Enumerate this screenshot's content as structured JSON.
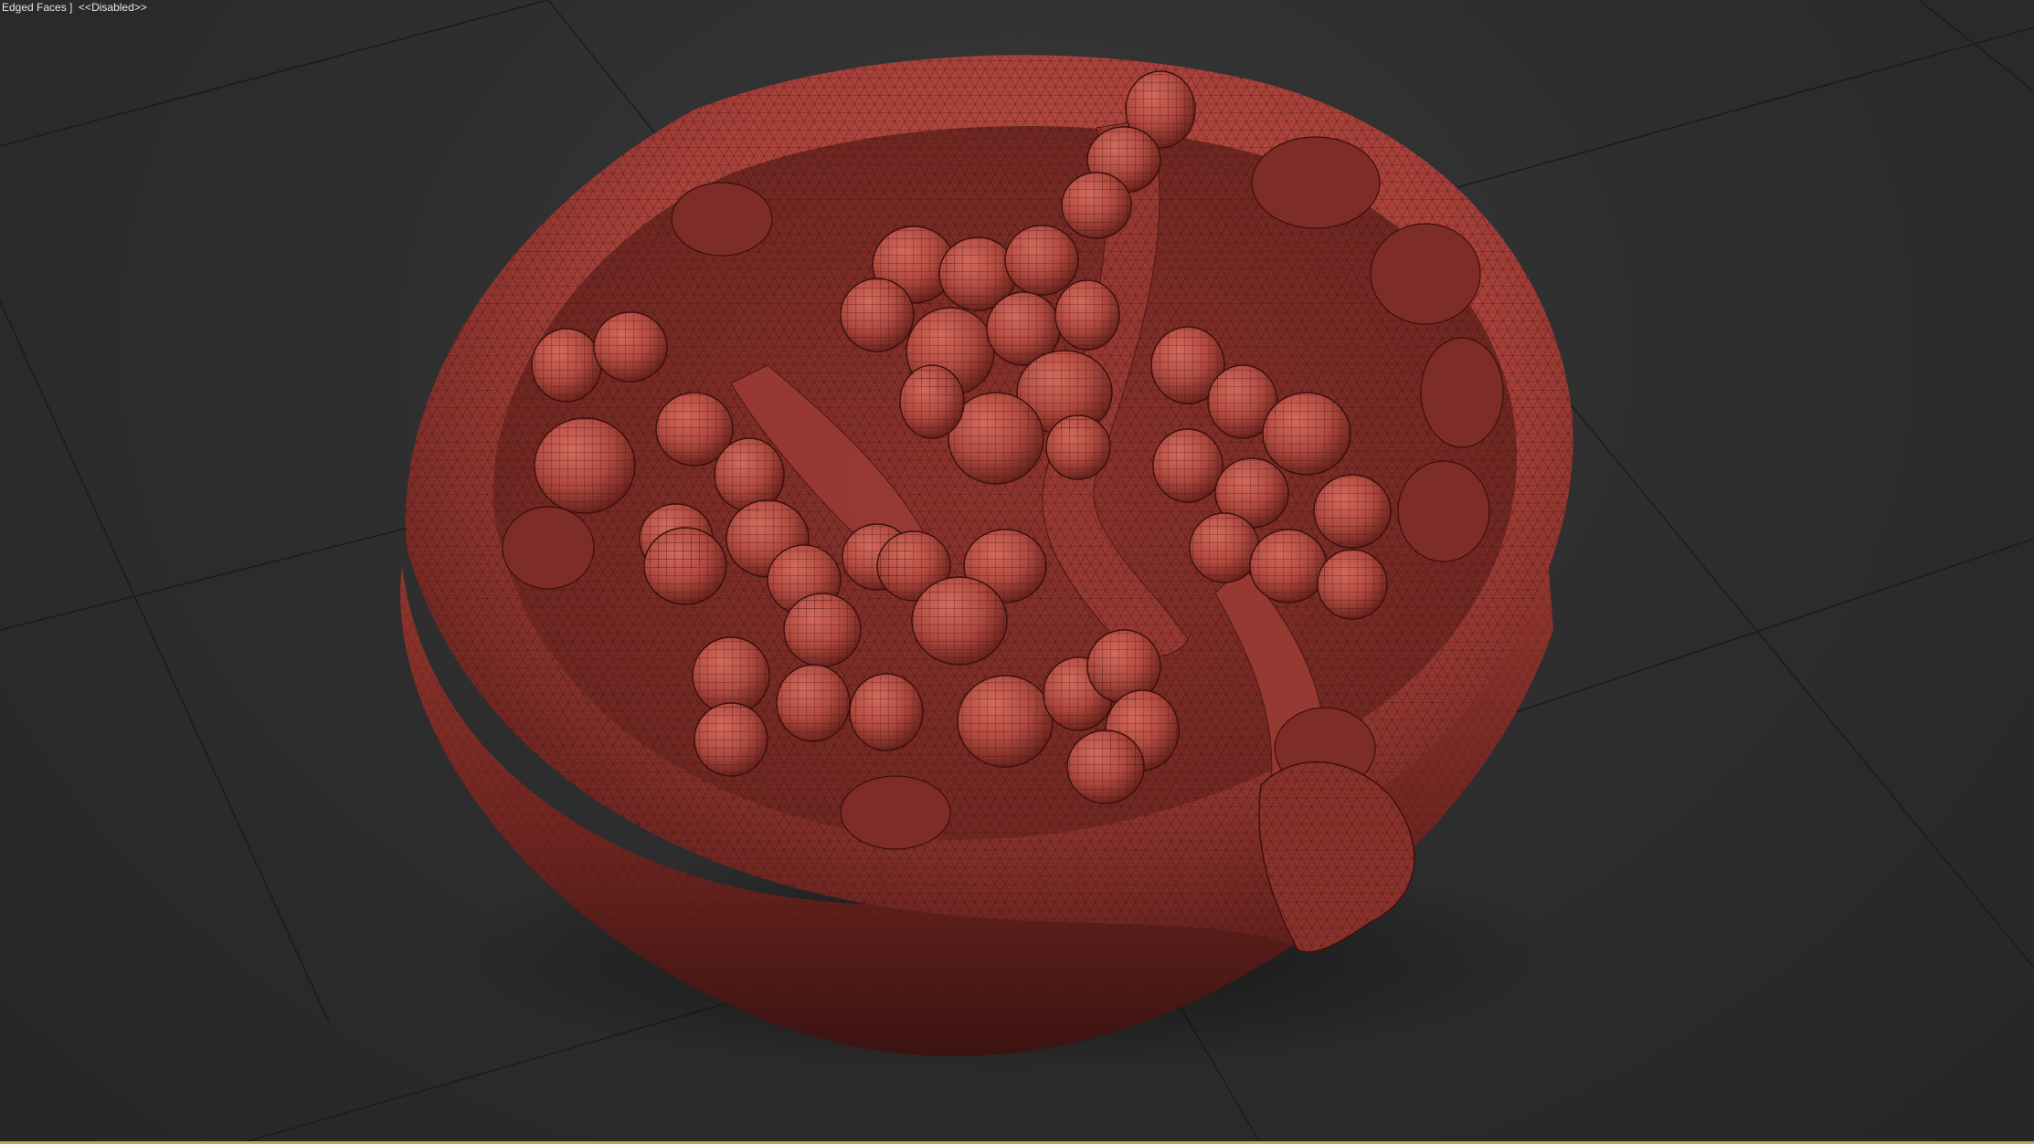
{
  "viewport": {
    "label_text": "Edged Faces ]  <<Disabled>>",
    "active_border_color": "#c8a24a"
  },
  "scene": {
    "object": "pomegranate-half-mesh",
    "shading_mode": "edged-faces",
    "mesh_color": "#b5483e",
    "wire_color": "#3a0f0c",
    "background_color": "#2b2b2b",
    "grid_color": "#1a1a1a"
  }
}
